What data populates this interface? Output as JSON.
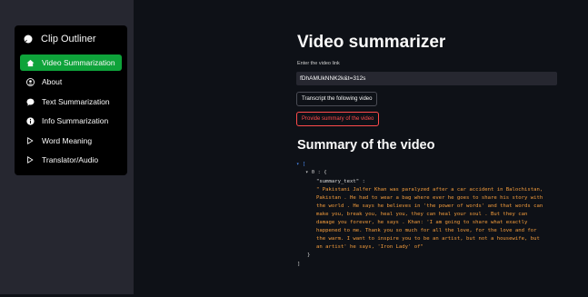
{
  "sidebar": {
    "header": {
      "title": "Clip Outliner",
      "icon": "chat-bubble-icon"
    },
    "items": [
      {
        "label": "Video Summarization",
        "icon": "home-icon",
        "active": true
      },
      {
        "label": "About",
        "icon": "person-icon",
        "active": false
      },
      {
        "label": "Text Summarization",
        "icon": "chat-bubble-icon",
        "active": false
      },
      {
        "label": "Info Summarization",
        "icon": "info-icon",
        "active": false
      },
      {
        "label": "Word Meaning",
        "icon": "play-outline-icon",
        "active": false
      },
      {
        "label": "Translator/Audio",
        "icon": "play-outline-icon",
        "active": false
      }
    ],
    "active_color": "#0ea33a"
  },
  "main": {
    "title": "Video summarizer",
    "link_label": "Enter the video link",
    "link_value": "fDhAMUkNNK2k&t=312s",
    "transcript_button": "Transcript the following video",
    "summary_button": "Provide summary of the video",
    "summary_heading": "Summary of the video",
    "result": {
      "root_toggle": "▾ [",
      "item_toggle": "▾ 0 : {",
      "key": "\"summary_text\" :",
      "lines": [
        "\" Pakistani Jalfer Khan was paralyzed after a car accident in Balochistan,",
        "Pakistan . He had to wear a bag where ever he goes to share his story with",
        "the world . He says he believes in 'the power of words' and that words can",
        "make you, break you, heal you, they can heal your soul . But they can",
        "damage you forever, he says . Khan: 'I am going to share what exactly",
        "happened to me. Thank you so much for all the love, for the love and for",
        "the warm. I want to inspire you to be an artist, but not a housewife, but",
        "an artist' he says, 'Iron Lady' of\""
      ],
      "close_item": "}",
      "close_root": "]"
    }
  },
  "colors": {
    "background": "#0e1117",
    "sidebar": "#262730",
    "danger": "#ff4b4b",
    "string": "#f39c3c",
    "toggle": "#4c8df5"
  }
}
